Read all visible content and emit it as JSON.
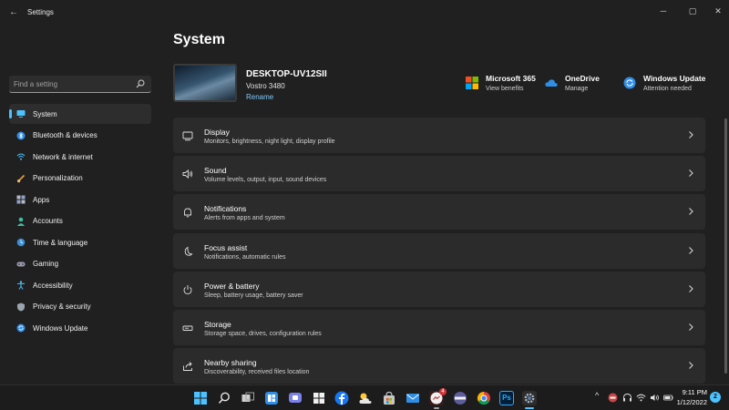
{
  "window": {
    "title": "Settings",
    "back_glyph": "←",
    "minimize_glyph": "─",
    "maximize_glyph": "▢",
    "close_glyph": "✕"
  },
  "search": {
    "placeholder": "Find a setting",
    "value": "",
    "icon": "search-icon"
  },
  "sidebar": {
    "accent_color": "#4cc2ff",
    "items": [
      {
        "label": "System",
        "icon": "monitor-icon",
        "selected": true
      },
      {
        "label": "Bluetooth & devices",
        "icon": "bluetooth-icon",
        "selected": false
      },
      {
        "label": "Network & internet",
        "icon": "wifi-icon",
        "selected": false
      },
      {
        "label": "Personalization",
        "icon": "brush-icon",
        "selected": false
      },
      {
        "label": "Apps",
        "icon": "apps-icon",
        "selected": false
      },
      {
        "label": "Accounts",
        "icon": "person-icon",
        "selected": false
      },
      {
        "label": "Time & language",
        "icon": "globe-clock-icon",
        "selected": false
      },
      {
        "label": "Gaming",
        "icon": "controller-icon",
        "selected": false
      },
      {
        "label": "Accessibility",
        "icon": "accessibility-icon",
        "selected": false
      },
      {
        "label": "Privacy & security",
        "icon": "shield-icon",
        "selected": false
      },
      {
        "label": "Windows Update",
        "icon": "update-icon",
        "selected": false
      }
    ]
  },
  "page": {
    "title": "System"
  },
  "device": {
    "name": "DESKTOP-UV12SII",
    "model": "Vostro 3480",
    "rename_label": "Rename"
  },
  "quick_links": [
    {
      "title": "Microsoft 365",
      "subtitle": "View benefits",
      "icon": "microsoft-logo-icon"
    },
    {
      "title": "OneDrive",
      "subtitle": "Manage",
      "icon": "cloud-icon"
    },
    {
      "title": "Windows Update",
      "subtitle": "Attention needed",
      "icon": "update-icon"
    }
  ],
  "cards": [
    {
      "title": "Display",
      "subtitle": "Monitors, brightness, night light, display profile",
      "icon": "display-icon"
    },
    {
      "title": "Sound",
      "subtitle": "Volume levels, output, input, sound devices",
      "icon": "speaker-icon"
    },
    {
      "title": "Notifications",
      "subtitle": "Alerts from apps and system",
      "icon": "bell-icon"
    },
    {
      "title": "Focus assist",
      "subtitle": "Notifications, automatic rules",
      "icon": "moon-icon"
    },
    {
      "title": "Power & battery",
      "subtitle": "Sleep, battery usage, battery saver",
      "icon": "power-icon"
    },
    {
      "title": "Storage",
      "subtitle": "Storage space, drives, configuration rules",
      "icon": "storage-icon"
    },
    {
      "title": "Nearby sharing",
      "subtitle": "Discoverability, received files location",
      "icon": "share-icon"
    }
  ],
  "taskbar": {
    "icons": [
      "start-icon",
      "search-icon",
      "task-view-icon",
      "widgets-icon",
      "teams-chat-icon",
      "microsoft-store-icon",
      "facebook-icon",
      "weather-icon",
      "store-bag-icon",
      "mail-icon",
      "messenger-icon",
      "app-icon",
      "chrome-icon",
      "photoshop-icon",
      "settings-icon"
    ],
    "messenger_badge": "4",
    "photoshop_label": "Ps",
    "tray_chevron": "^",
    "clock_time": "9:11 PM",
    "clock_date": "1/12/2022",
    "notification_count": "2"
  }
}
